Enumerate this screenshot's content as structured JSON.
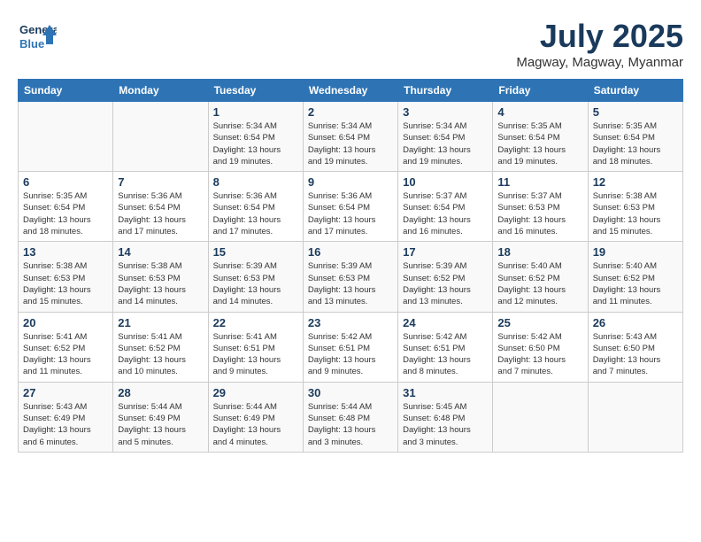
{
  "header": {
    "logo_line1": "General",
    "logo_line2": "Blue",
    "month_title": "July 2025",
    "location": "Magway, Magway, Myanmar"
  },
  "weekdays": [
    "Sunday",
    "Monday",
    "Tuesday",
    "Wednesday",
    "Thursday",
    "Friday",
    "Saturday"
  ],
  "weeks": [
    [
      {
        "day": "",
        "info": ""
      },
      {
        "day": "",
        "info": ""
      },
      {
        "day": "1",
        "info": "Sunrise: 5:34 AM\nSunset: 6:54 PM\nDaylight: 13 hours\nand 19 minutes."
      },
      {
        "day": "2",
        "info": "Sunrise: 5:34 AM\nSunset: 6:54 PM\nDaylight: 13 hours\nand 19 minutes."
      },
      {
        "day": "3",
        "info": "Sunrise: 5:34 AM\nSunset: 6:54 PM\nDaylight: 13 hours\nand 19 minutes."
      },
      {
        "day": "4",
        "info": "Sunrise: 5:35 AM\nSunset: 6:54 PM\nDaylight: 13 hours\nand 19 minutes."
      },
      {
        "day": "5",
        "info": "Sunrise: 5:35 AM\nSunset: 6:54 PM\nDaylight: 13 hours\nand 18 minutes."
      }
    ],
    [
      {
        "day": "6",
        "info": "Sunrise: 5:35 AM\nSunset: 6:54 PM\nDaylight: 13 hours\nand 18 minutes."
      },
      {
        "day": "7",
        "info": "Sunrise: 5:36 AM\nSunset: 6:54 PM\nDaylight: 13 hours\nand 17 minutes."
      },
      {
        "day": "8",
        "info": "Sunrise: 5:36 AM\nSunset: 6:54 PM\nDaylight: 13 hours\nand 17 minutes."
      },
      {
        "day": "9",
        "info": "Sunrise: 5:36 AM\nSunset: 6:54 PM\nDaylight: 13 hours\nand 17 minutes."
      },
      {
        "day": "10",
        "info": "Sunrise: 5:37 AM\nSunset: 6:54 PM\nDaylight: 13 hours\nand 16 minutes."
      },
      {
        "day": "11",
        "info": "Sunrise: 5:37 AM\nSunset: 6:53 PM\nDaylight: 13 hours\nand 16 minutes."
      },
      {
        "day": "12",
        "info": "Sunrise: 5:38 AM\nSunset: 6:53 PM\nDaylight: 13 hours\nand 15 minutes."
      }
    ],
    [
      {
        "day": "13",
        "info": "Sunrise: 5:38 AM\nSunset: 6:53 PM\nDaylight: 13 hours\nand 15 minutes."
      },
      {
        "day": "14",
        "info": "Sunrise: 5:38 AM\nSunset: 6:53 PM\nDaylight: 13 hours\nand 14 minutes."
      },
      {
        "day": "15",
        "info": "Sunrise: 5:39 AM\nSunset: 6:53 PM\nDaylight: 13 hours\nand 14 minutes."
      },
      {
        "day": "16",
        "info": "Sunrise: 5:39 AM\nSunset: 6:53 PM\nDaylight: 13 hours\nand 13 minutes."
      },
      {
        "day": "17",
        "info": "Sunrise: 5:39 AM\nSunset: 6:52 PM\nDaylight: 13 hours\nand 13 minutes."
      },
      {
        "day": "18",
        "info": "Sunrise: 5:40 AM\nSunset: 6:52 PM\nDaylight: 13 hours\nand 12 minutes."
      },
      {
        "day": "19",
        "info": "Sunrise: 5:40 AM\nSunset: 6:52 PM\nDaylight: 13 hours\nand 11 minutes."
      }
    ],
    [
      {
        "day": "20",
        "info": "Sunrise: 5:41 AM\nSunset: 6:52 PM\nDaylight: 13 hours\nand 11 minutes."
      },
      {
        "day": "21",
        "info": "Sunrise: 5:41 AM\nSunset: 6:52 PM\nDaylight: 13 hours\nand 10 minutes."
      },
      {
        "day": "22",
        "info": "Sunrise: 5:41 AM\nSunset: 6:51 PM\nDaylight: 13 hours\nand 9 minutes."
      },
      {
        "day": "23",
        "info": "Sunrise: 5:42 AM\nSunset: 6:51 PM\nDaylight: 13 hours\nand 9 minutes."
      },
      {
        "day": "24",
        "info": "Sunrise: 5:42 AM\nSunset: 6:51 PM\nDaylight: 13 hours\nand 8 minutes."
      },
      {
        "day": "25",
        "info": "Sunrise: 5:42 AM\nSunset: 6:50 PM\nDaylight: 13 hours\nand 7 minutes."
      },
      {
        "day": "26",
        "info": "Sunrise: 5:43 AM\nSunset: 6:50 PM\nDaylight: 13 hours\nand 7 minutes."
      }
    ],
    [
      {
        "day": "27",
        "info": "Sunrise: 5:43 AM\nSunset: 6:49 PM\nDaylight: 13 hours\nand 6 minutes."
      },
      {
        "day": "28",
        "info": "Sunrise: 5:44 AM\nSunset: 6:49 PM\nDaylight: 13 hours\nand 5 minutes."
      },
      {
        "day": "29",
        "info": "Sunrise: 5:44 AM\nSunset: 6:49 PM\nDaylight: 13 hours\nand 4 minutes."
      },
      {
        "day": "30",
        "info": "Sunrise: 5:44 AM\nSunset: 6:48 PM\nDaylight: 13 hours\nand 3 minutes."
      },
      {
        "day": "31",
        "info": "Sunrise: 5:45 AM\nSunset: 6:48 PM\nDaylight: 13 hours\nand 3 minutes."
      },
      {
        "day": "",
        "info": ""
      },
      {
        "day": "",
        "info": ""
      }
    ]
  ]
}
